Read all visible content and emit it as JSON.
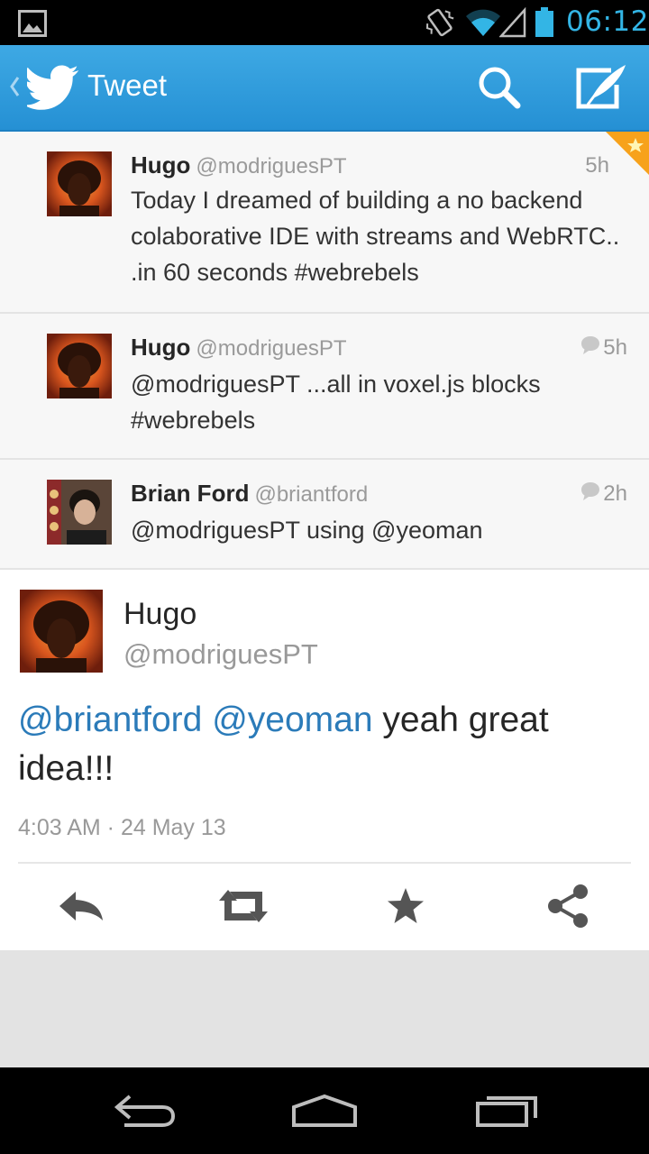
{
  "status_bar": {
    "time": "06:12",
    "icons": [
      "image-notification-icon",
      "vibrate-icon",
      "wifi-icon",
      "signal-icon",
      "battery-icon"
    ]
  },
  "action_bar": {
    "title": "Tweet",
    "icons": [
      "up-chevron-icon",
      "twitter-bird-icon",
      "search-icon",
      "compose-icon"
    ]
  },
  "conversation": [
    {
      "name": "Hugo",
      "handle": "@modriguesPT",
      "time": "5h",
      "text": "Today I dreamed of building a no backend colaborative IDE with streams and WebRTC.. .in 60 seconds #webrebels",
      "lines": [
        "Today I dreamed of building a no backend",
        "colaborative IDE with streams and WebRTC..",
        ".in 60 seconds #webrebels"
      ]
    },
    {
      "name": "Hugo",
      "handle": "@modriguesPT",
      "time": "5h",
      "text": "@modriguesPT ...all in voxel.js blocks #webrebels",
      "lines": [
        "@modriguesPT ...all in voxel.js blocks",
        "#webrebels"
      ]
    },
    {
      "name": "Brian Ford",
      "handle": "@briantford",
      "time": "2h",
      "text": "@modriguesPT using @yeoman",
      "lines": [
        "@modriguesPT using @yeoman"
      ]
    }
  ],
  "tweet": {
    "name": "Hugo",
    "handle": "@modriguesPT",
    "mention_1": "@briantford",
    "mention_2": "@yeoman",
    "body_rest": " yeah great",
    "body_line2": "idea!!!",
    "timestamp": "4:03 AM · 24 May 13",
    "actions": [
      "reply-icon",
      "retweet-icon",
      "favorite-icon",
      "share-icon"
    ]
  },
  "colors": {
    "status_time": "#33b5e5",
    "action_bar": "#2a97d8",
    "mention": "#2b7bb9",
    "favorite_corner": "#f7a21b"
  },
  "nav_bar": {
    "icons": [
      "back-icon",
      "home-icon",
      "recents-icon"
    ]
  }
}
